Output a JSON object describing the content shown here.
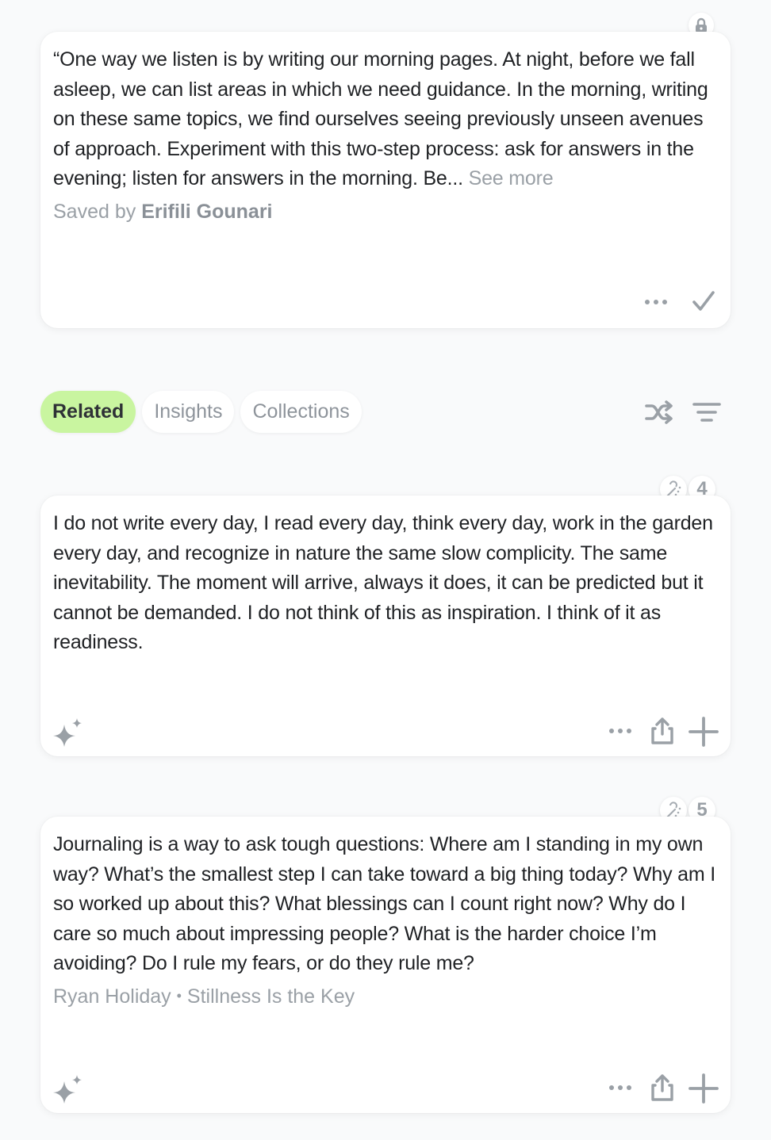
{
  "saved_card": {
    "text": "“One way we listen is by writing our morning pages. At night, before we fall asleep, we can list areas in which we need guidance. In the morning, writing on these same topics, we find ourselves seeing previously unseen avenues of approach. Experiment with this two-step process: ask for answers in the evening; listen for answers in the morning. Be...",
    "see_more": "See more",
    "saved_by_prefix": "Saved by",
    "saved_by_name": "Erifili Gounari",
    "icons": [
      "lock-icon",
      "more-icon",
      "check-icon"
    ]
  },
  "tabs": [
    {
      "label": "Related",
      "active": true
    },
    {
      "label": "Insights",
      "active": false
    },
    {
      "label": "Collections",
      "active": false
    }
  ],
  "toolbar_icons": [
    "shuffle-icon",
    "filter-icon"
  ],
  "related": [
    {
      "count": "4",
      "text": "I do not write every day, I read every day, think every day, work in the garden every day, and recognize in nature the same slow complicity. The same inevitability. The moment will arrive, always it does, it can be predicted but it cannot be demanded. I do not think of this as inspiration. I think of it as readiness."
    },
    {
      "count": "5",
      "text": "Journaling is a way to ask tough questions: Where am I standing in my own way? What’s the smallest step I can take toward a big thing today? Why am I so worked up about this? What blessings can I count right now? Why do I care so much about impressing people? What is the harder choice I’m avoiding? Do I rule my fears, or do they rule me?",
      "author": "Ryan Holiday",
      "separator": "•",
      "source": "Stillness Is the Key"
    }
  ],
  "colors": {
    "active_tab": "#c9f5a0",
    "icon_gray": "#9aa0a6",
    "background": "#f9fafb"
  }
}
